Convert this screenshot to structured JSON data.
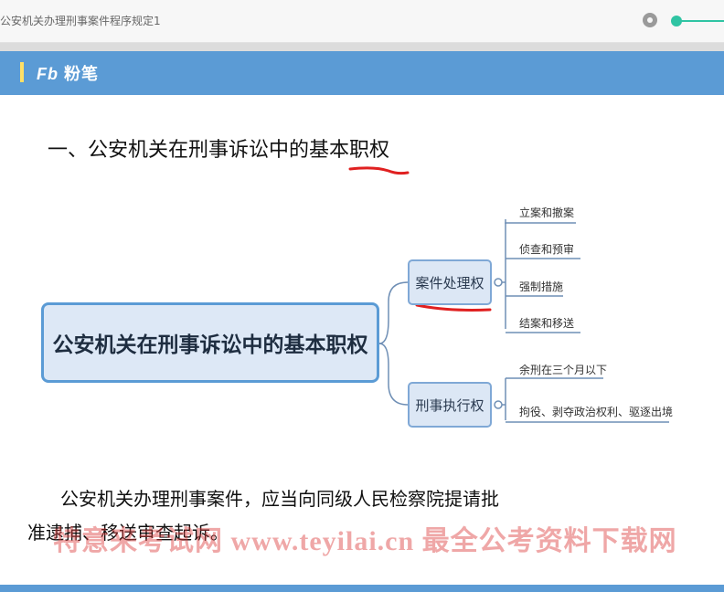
{
  "window": {
    "title": "公安机关办理刑事案件程序规定1"
  },
  "brand": {
    "prefix": "Fb",
    "name": "粉笔"
  },
  "slide": {
    "heading": "一、公安机关在刑事诉讼中的基本职权",
    "mindmap": {
      "central": "公安机关在刑事诉讼中的基本职权",
      "branches": [
        {
          "label": "案件处理权",
          "leaves": [
            "立案和撤案",
            "侦查和预审",
            "强制措施",
            "结案和移送"
          ]
        },
        {
          "label": "刑事执行权",
          "leaves": [
            "余刑在三个月以下",
            "拘役、剥夺政治权利、驱逐出境"
          ]
        }
      ]
    },
    "paragraph_line1": "公安机关办理刑事案件，应当向同级人民检察院提请批",
    "paragraph_line2": "准逮捕、移送审查起诉。"
  },
  "watermark": "特意来考试网 www.teyilai.cn 最全公考资料下载网",
  "colors": {
    "accent": "#5b9bd5",
    "annotation": "#e02020",
    "slider": "#2fc4a3"
  }
}
